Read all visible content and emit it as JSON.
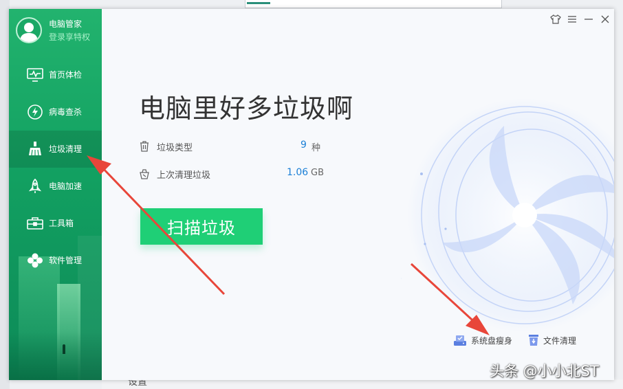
{
  "user": {
    "name": "电脑管家",
    "subtitle": "登录享特权"
  },
  "nav": [
    {
      "label": "首页体检",
      "icon": "monitor-icon"
    },
    {
      "label": "病毒查杀",
      "icon": "lightning-icon"
    },
    {
      "label": "垃圾清理",
      "icon": "broom-icon",
      "active": true
    },
    {
      "label": "电脑加速",
      "icon": "rocket-icon"
    },
    {
      "label": "工具箱",
      "icon": "toolbox-icon"
    },
    {
      "label": "软件管理",
      "icon": "clover-icon"
    }
  ],
  "main": {
    "headline": "电脑里好多垃圾啊",
    "stats": [
      {
        "label": "垃圾类型",
        "value": "9",
        "unit": "种",
        "icon": "trash-icon"
      },
      {
        "label": "上次清理垃圾",
        "value": "1.06",
        "unit": "GB",
        "icon": "bin-icon"
      }
    ],
    "scan_button": "扫描垃圾",
    "bottom_links": [
      {
        "label": "系统盘瘦身",
        "icon": "disk-icon"
      },
      {
        "label": "文件清理",
        "icon": "file-clean-icon"
      }
    ]
  },
  "window_controls": [
    "skin-icon",
    "menu-icon",
    "minimize-icon",
    "close-icon"
  ],
  "colors": {
    "sidebar": "#12a061",
    "accent": "#1fcf76",
    "value_blue": "#1a7fd6",
    "arrow": "#e8463a"
  },
  "watermark": "头条 @小小北ST",
  "behind": {
    "setting": "设置"
  }
}
